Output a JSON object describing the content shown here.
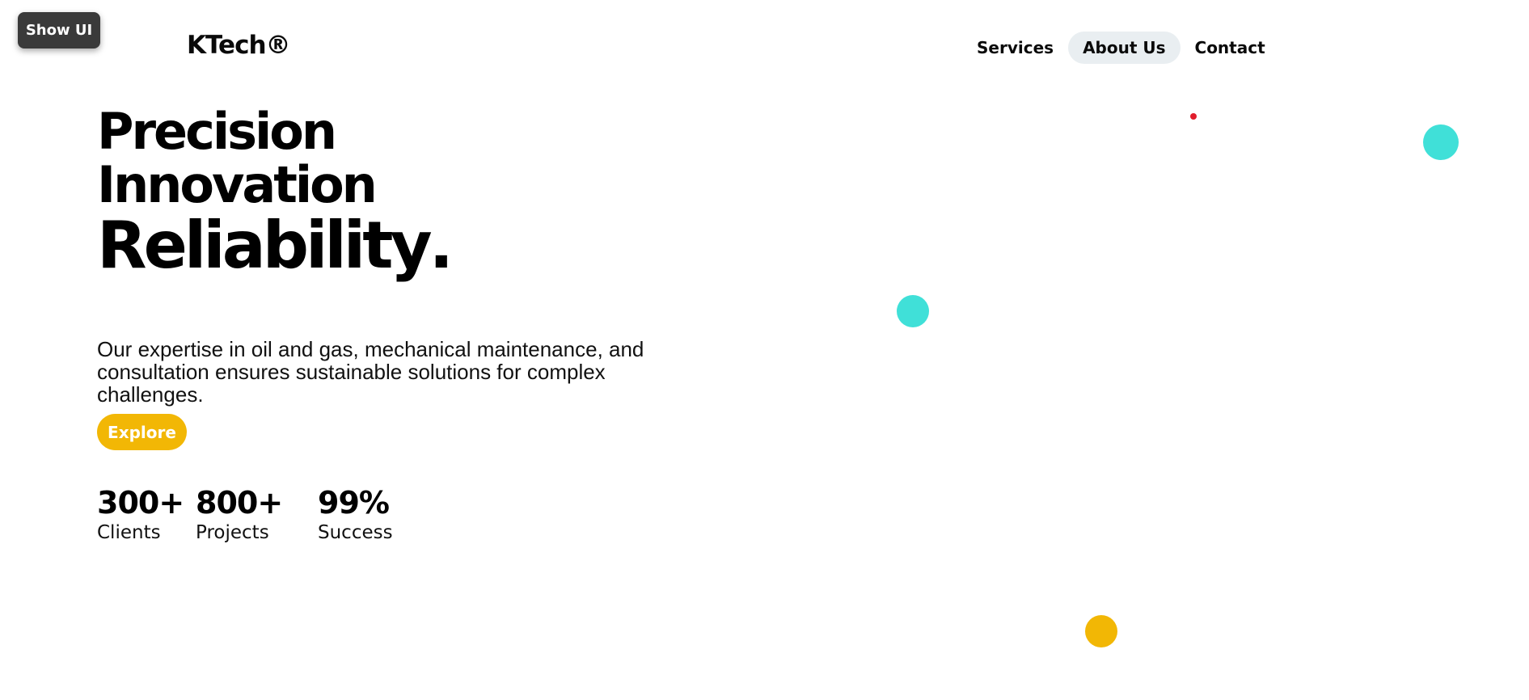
{
  "toolbar": {
    "show_ui_label": "Show UI"
  },
  "brand": {
    "logo_text": "KTech®"
  },
  "nav": {
    "services": "Services",
    "about": "About Us",
    "contact": "Contact",
    "active": "About Us"
  },
  "hero": {
    "line1": "Precision",
    "line2": "Innovation",
    "line3": "Reliability",
    "line3_suffix": ".",
    "description": "Our expertise in oil and gas, mechanical maintenance, and consultation ensures sustainable solutions for complex challenges.",
    "cta_label": "Explore"
  },
  "stats": [
    {
      "value": "300+",
      "label": "Clients"
    },
    {
      "value": "800+",
      "label": "Projects"
    },
    {
      "value": "99%",
      "label": "Success"
    }
  ],
  "colors": {
    "accent_yellow": "#f2b705",
    "accent_cyan": "#40e0d8",
    "helmet_red": "#e11d2c",
    "photo_bg": "#94a3ac"
  },
  "icons": {
    "registered": "registered-mark"
  }
}
